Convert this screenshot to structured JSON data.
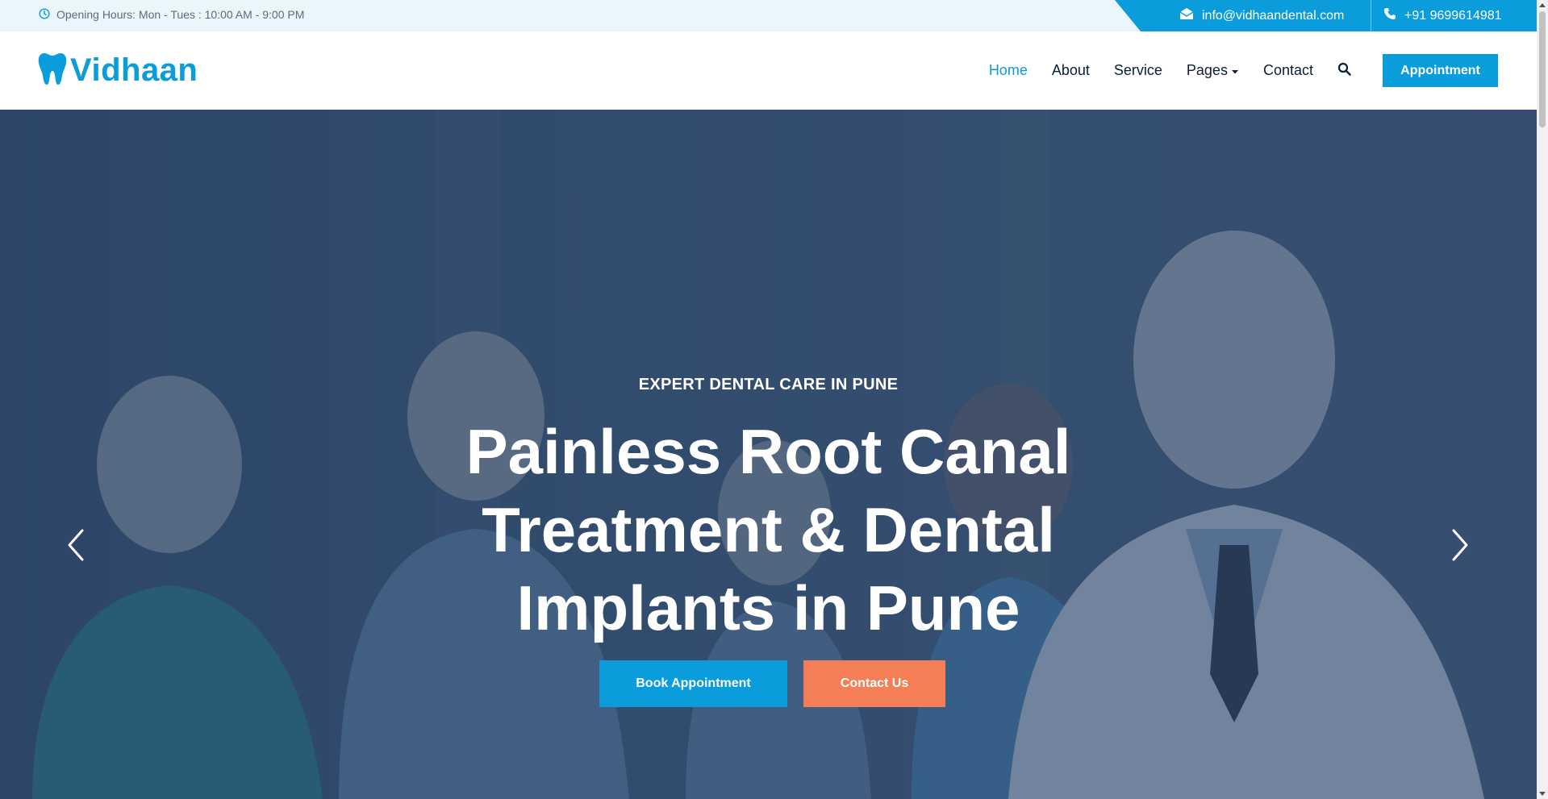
{
  "topbar": {
    "hours_text": "Opening Hours: Mon - Tues : 10:00 AM - 9:00 PM",
    "email": "info@vidhaandental.com",
    "phone": "+91 9699614981",
    "icons": {
      "clock": "clock-icon",
      "mail": "envelope-icon",
      "phone": "phone-icon"
    }
  },
  "brand": {
    "name": "Vidhaan",
    "icon": "tooth-icon",
    "color": "#0a9cdb"
  },
  "nav": {
    "items": [
      {
        "label": "Home",
        "active": true
      },
      {
        "label": "About",
        "active": false
      },
      {
        "label": "Service",
        "active": false
      },
      {
        "label": "Pages",
        "active": false
      },
      {
        "label": "Contact",
        "active": false
      }
    ],
    "search_icon": "search-icon",
    "appointment_label": "Appointment"
  },
  "hero": {
    "eyebrow": "EXPERT DENTAL CARE IN PUNE",
    "title": "Painless Root Canal Treatment & Dental Implants in Pune",
    "book_label": "Book Appointment",
    "contact_label": "Contact Us",
    "prev_icon": "chevron-left-icon",
    "next_icon": "chevron-right-icon"
  },
  "colors": {
    "accent": "#0a9cdb",
    "secondary": "#f47f57",
    "nav_text": "#0b1d3a"
  }
}
